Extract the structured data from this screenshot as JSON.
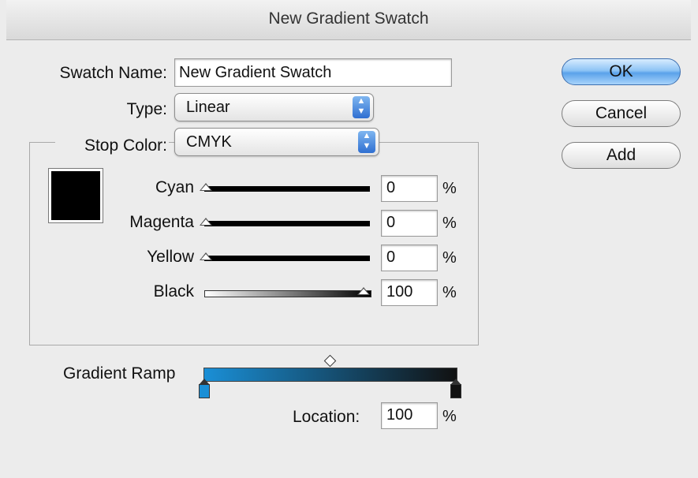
{
  "dialog": {
    "title": "New Gradient Swatch"
  },
  "swatch_name": {
    "label": "Swatch Name:",
    "value": "New Gradient Swatch"
  },
  "type": {
    "label": "Type:",
    "value": "Linear"
  },
  "stop_color": {
    "label": "Stop Color:",
    "value": "CMYK",
    "preview_color": "#000000"
  },
  "sliders": [
    {
      "label": "Cyan",
      "value": "0",
      "unit": "%",
      "fraction": 0.0
    },
    {
      "label": "Magenta",
      "value": "0",
      "unit": "%",
      "fraction": 0.0
    },
    {
      "label": "Yellow",
      "value": "0",
      "unit": "%",
      "fraction": 0.0
    },
    {
      "label": "Black",
      "value": "100",
      "unit": "%",
      "fraction": 1.0
    }
  ],
  "gradient_ramp": {
    "label": "Gradient Ramp",
    "start_color": "#1a8fd6",
    "end_color": "#111111",
    "midpoint_fraction": 0.5
  },
  "location": {
    "label": "Location:",
    "value": "100",
    "unit": "%"
  },
  "buttons": {
    "ok": "OK",
    "cancel": "Cancel",
    "add": "Add"
  },
  "colors": {
    "accent": "#5aa2ea",
    "window_bg": "#ececec"
  }
}
